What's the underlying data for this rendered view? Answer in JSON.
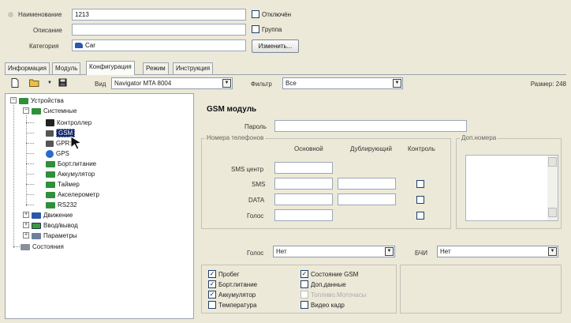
{
  "header": {
    "name_label": "Наименование",
    "name_value": "1213",
    "description_label": "Описание",
    "description_value": "",
    "category_label": "Категория",
    "category_value": "Car",
    "disabled_label": "Отключён",
    "group_label": "Группа",
    "change_button": "Изменить..."
  },
  "tabs": [
    {
      "label": "Информация"
    },
    {
      "label": "Модуль"
    },
    {
      "label": "Конфигурация"
    },
    {
      "label": "Режим"
    },
    {
      "label": "Инструкция"
    }
  ],
  "toolbar": {
    "view_label": "Вид",
    "view_value": "Navigator MTA 8004",
    "filter_label": "Фильтр",
    "filter_value": "Все",
    "size_text": "Размер: 248"
  },
  "tree": {
    "devices": "Устройства",
    "system": "Системные",
    "controller": "Контроллер",
    "gsm": "GSM",
    "gprs": "GPRS",
    "gps": "GPS",
    "onboard_power": "Борт.питание",
    "battery": "Аккумулятор",
    "timer": "Таймер",
    "accelerometer": "Акселерометр",
    "rs232": "RS232",
    "motion": "Движение",
    "io": "Ввод/вывод",
    "params": "Параметры",
    "states": "Состояния"
  },
  "panel": {
    "title": "GSM модуль",
    "password_label": "Пароль",
    "password_value": "",
    "phones_group": "Номера телефонов",
    "col_main": "Основной",
    "col_backup": "Дублирующий",
    "col_control": "Контроль",
    "row_sms_center": "SMS центр",
    "row_sms": "SMS",
    "row_data": "DATA",
    "row_voice": "Голос",
    "extra_group": "Доп.номера",
    "voice_label": "Голос",
    "voice_value": "Нет",
    "bchi_label": "БЧИ",
    "bchi_value": "Нет"
  },
  "options": {
    "mileage": {
      "label": "Пробег",
      "checked": true
    },
    "onboard_power": {
      "label": "Борт.питание",
      "checked": true
    },
    "battery": {
      "label": "Аккумулятор",
      "checked": true
    },
    "temperature": {
      "label": "Температура",
      "checked": false
    },
    "gsm_state": {
      "label": "Состояние GSM",
      "checked": true
    },
    "extra_data": {
      "label": "Доп.данные",
      "checked": false
    },
    "fuel_hours": {
      "label": "Топливо.Моточасы",
      "checked": false
    },
    "video_frame": {
      "label": "Видео кадр",
      "checked": false
    }
  }
}
